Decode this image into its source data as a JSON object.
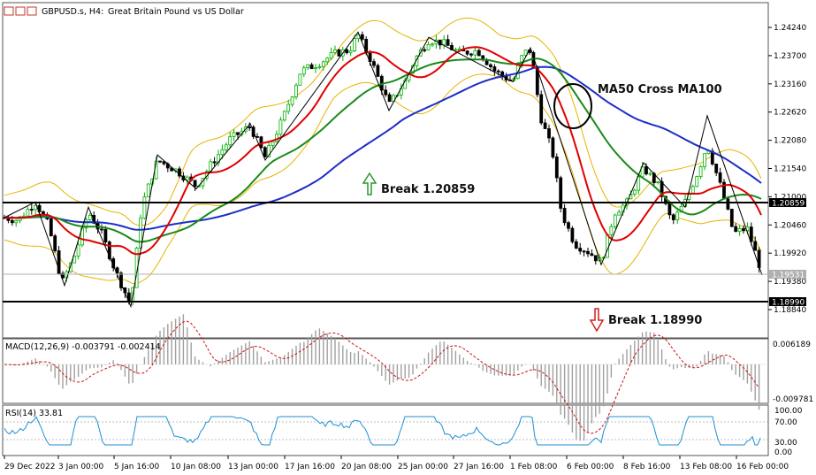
{
  "header": {
    "symbol": "GBPUSD.s, H4:",
    "description": "Great Britain Pound vs US Dollar"
  },
  "price_axis": {
    "ticks": [
      "1.24240",
      "1.23700",
      "1.23160",
      "1.22620",
      "1.22080",
      "1.21540",
      "1.21000",
      "1.20460",
      "1.19920",
      "1.19380",
      "1.18840"
    ],
    "badges": [
      "1.20859",
      "1.19531",
      "1.18990"
    ]
  },
  "time_axis": {
    "labels": [
      "29 Dec 2022",
      "3 Jan 00:00",
      "5 Jan 16:00",
      "10 Jan 08:00",
      "13 Jan 00:00",
      "17 Jan 16:00",
      "20 Jan 08:00",
      "25 Jan 00:00",
      "27 Jan 16:00",
      "1 Feb 08:00",
      "6 Feb 00:00",
      "8 Feb 16:00",
      "13 Feb 08:00",
      "16 Feb 00:00"
    ]
  },
  "annotations": {
    "ma_cross": "MA50 Cross MA100",
    "break_up": "Break 1.20859",
    "break_down": "Break 1.18990"
  },
  "macd": {
    "label": "MACD(12,26,9) -0.003791 -0.002414",
    "axis_top": "0.006189",
    "axis_bottom": "-0.009781"
  },
  "rsi": {
    "label": "RSI(14) 33.81",
    "levels": [
      "100.00",
      "70.00",
      "30.00",
      "0.00"
    ]
  },
  "colors": {
    "bull_candle": "#00b000",
    "bear_candle": "#000000",
    "ma_fast": "#e00000",
    "ma50": "#1a8a1a",
    "ma100": "#1c2fc7",
    "bollinger": "#e6b400",
    "macd_hist": "#a0a0a0",
    "macd_signal": "#d01010",
    "rsi_line": "#1e8fd6",
    "zigzag": "#000000",
    "up_arrow": "#2a9a2a",
    "down_arrow": "#d02020"
  },
  "chart_data": {
    "type": "line",
    "x": [
      "29 Dec 2022",
      "3 Jan 00:00",
      "5 Jan 16:00",
      "10 Jan 08:00",
      "13 Jan 00:00",
      "17 Jan 16:00",
      "20 Jan 08:00",
      "25 Jan 00:00",
      "27 Jan 16:00",
      "1 Feb 08:00",
      "6 Feb 00:00",
      "8 Feb 16:00",
      "13 Feb 08:00",
      "16 Feb 00:00"
    ],
    "series": [
      {
        "name": "Price",
        "values": [
          1.206,
          1.1935,
          1.1892,
          1.215,
          1.226,
          1.236,
          1.2395,
          1.2365,
          1.2375,
          1.238,
          1.1975,
          1.2155,
          1.213,
          1.2
        ]
      },
      {
        "name": "MA50",
        "values": [
          1.2085,
          1.208,
          1.204,
          1.209,
          1.218,
          1.226,
          1.23,
          1.233,
          1.235,
          1.233,
          1.223,
          1.215,
          1.212,
          1.211
        ]
      },
      {
        "name": "MA100",
        "values": [
          1.212,
          1.211,
          1.208,
          1.21,
          1.215,
          1.2205,
          1.225,
          1.229,
          1.2305,
          1.231,
          1.227,
          1.221,
          1.218,
          1.216
        ]
      }
    ],
    "levels": [
      1.20859,
      1.1899
    ],
    "last_price": 1.19531,
    "ylim": [
      1.188,
      1.245
    ],
    "macd": {
      "last": -0.003791,
      "signal": -0.002414,
      "ylim": [
        -0.009781,
        0.006189
      ]
    },
    "rsi": {
      "last": 33.81,
      "ylim": [
        0,
        100
      ],
      "levels": [
        70,
        30
      ]
    }
  }
}
